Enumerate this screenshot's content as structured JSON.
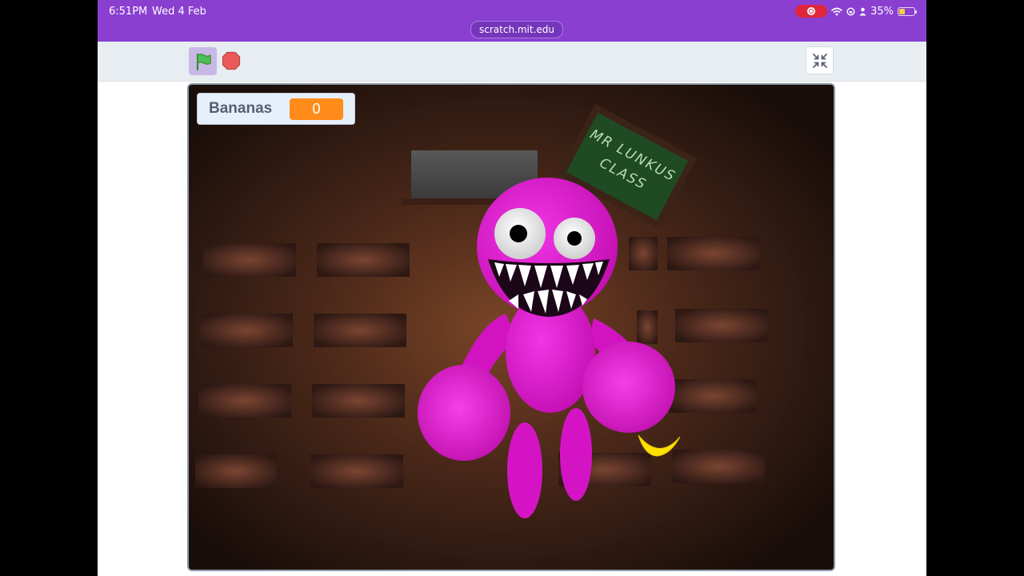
{
  "status_bar": {
    "time": "6:51PM",
    "date": "Wed 4 Feb",
    "battery": "35%",
    "battery_level": 0.35
  },
  "address_bar": {
    "url": "scratch.mit.edu"
  },
  "controls": {
    "green_flag_icon": "green-flag-icon",
    "stop_icon": "stop-sign-icon",
    "exit_fullscreen_icon": "collapse-arrows-icon"
  },
  "stage": {
    "variable_monitor": {
      "label": "Bananas",
      "value": "0"
    },
    "chalkboard_text": "MR LUNKUS CLASS"
  },
  "colors": {
    "browser_bar": "#8a3fd1",
    "monster": "#e01bd0",
    "monitor_value_bg": "#ff8c1a",
    "banana": "#ffe100",
    "chalkboard": "#1f4a22"
  }
}
